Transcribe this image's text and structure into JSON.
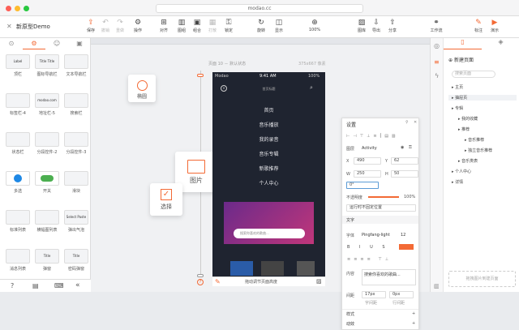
{
  "window": {
    "url": "modao.cc"
  },
  "doc": {
    "title": "新原型Demo"
  },
  "toolbar": {
    "items": [
      "保存",
      "撤销",
      "重做",
      "操作",
      "对齐",
      "图组",
      "组合",
      "打散",
      "锁定",
      "旋转",
      "显示",
      "100%",
      "图库",
      "导出",
      "分享",
      "工作流",
      "标注",
      "演示"
    ]
  },
  "left": {
    "components": [
      {
        "name": "顶栏",
        "p": "Label"
      },
      {
        "name": "图标导航栏",
        "p": "Title Title"
      },
      {
        "name": "文本导航栏",
        "p": ""
      },
      {
        "name": "标签栏-4",
        "p": ""
      },
      {
        "name": "地址栏-5",
        "p": "modao.com"
      },
      {
        "name": "搜索栏",
        "p": ""
      },
      {
        "name": "状态栏",
        "p": ""
      },
      {
        "name": "分段控件-2",
        "p": ""
      },
      {
        "name": "分段控件-3",
        "p": ""
      },
      {
        "name": "多选",
        "p": ""
      },
      {
        "name": "开关",
        "p": ""
      },
      {
        "name": "滑块",
        "p": ""
      },
      {
        "name": "标准列表",
        "p": ""
      },
      {
        "name": "横幅图列表",
        "p": ""
      },
      {
        "name": "弹出气泡",
        "p": "Select Paste"
      },
      {
        "name": "消息列表",
        "p": ""
      },
      {
        "name": "弹窗",
        "p": "Title"
      },
      {
        "name": "密码弹窗",
        "p": "Title"
      }
    ]
  },
  "canvas": {
    "page_label": "页面 10 － 默认状态",
    "size_label": "375x667 像素",
    "statusbar": {
      "carrier": "Modao",
      "time": "9:41 AM",
      "battery": "100%"
    },
    "nav_title": "首页标题",
    "menu": [
      "首页",
      "音乐播放",
      "我的录音",
      "音乐专辑",
      "新歌推荐",
      "个人中心"
    ],
    "search_placeholder": "搜索你喜欢的歌曲...",
    "bottom_hint": "拖动调节页面高度",
    "cards": {
      "circle": "椭圆",
      "image": "图片",
      "check": "选择"
    }
  },
  "props": {
    "header": "设置",
    "layer_label": "图层",
    "layer_name": "Activity",
    "x": "490",
    "y": "62",
    "w": "250",
    "h": "50",
    "rot": "0°",
    "opacity_label": "不透明度",
    "opacity": "100%",
    "opacity_value": 1.0,
    "fixed": "运行时不固定位置",
    "text_section": "文字",
    "font_label": "字体",
    "font": "Pingfang-light",
    "font_size": "12",
    "content_label": "内容",
    "content": "搜索你喜欢的歌曲...",
    "spacing_label": "间距",
    "letter": "17px",
    "line": "0px",
    "letter_lb": "字间距",
    "line_lb": "行间距",
    "style_section": "样式",
    "anim_section": "动效",
    "accent": "#f36a35"
  },
  "right": {
    "new_page": "新建页面",
    "search_placeholder": "搜索页面",
    "pages": [
      {
        "t": "主页",
        "d": 0
      },
      {
        "t": "抽屉页",
        "d": 0
      },
      {
        "t": "专辑",
        "d": 0
      },
      {
        "t": "我的收藏",
        "d": 1
      },
      {
        "t": "推荐",
        "d": 1
      },
      {
        "t": "音乐推荐",
        "d": 2
      },
      {
        "t": "独立音乐推荐",
        "d": 2
      },
      {
        "t": "音乐类表",
        "d": 1
      },
      {
        "t": "个人中心",
        "d": 0
      },
      {
        "t": "详情",
        "d": 0
      }
    ],
    "drop_hint": "拖拽图片到建页面"
  }
}
